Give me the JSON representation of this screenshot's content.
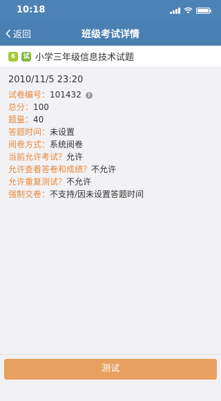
{
  "status_bar": {
    "time": "10:18",
    "icons": [
      "signal-icon",
      "wifi-icon",
      "battery-icon"
    ]
  },
  "nav": {
    "back_label": "返回",
    "title": "班级考试详情"
  },
  "exam": {
    "number_badge": "6",
    "type_badge": "试",
    "title": "小学三年级信息技术试题"
  },
  "details": {
    "date": "2010/11/5 23:20",
    "rows": [
      {
        "label": "试卷编号：",
        "value": "101432"
      },
      {
        "label": "总分：",
        "value": "100"
      },
      {
        "label": "题量：",
        "value": "40"
      },
      {
        "label": "答题时间：",
        "value": "未设置"
      },
      {
        "label": "阅卷方式：",
        "value": "系统阅卷"
      },
      {
        "label": "当前允许考试？",
        "value": "允许"
      },
      {
        "label": "允许查看答卷和成绩？",
        "value": "不允许"
      },
      {
        "label": "允许重复测试？",
        "value": "不允许"
      },
      {
        "label": "强制交卷：",
        "value": "不支持/因未设置答题时间"
      }
    ]
  },
  "actions": {
    "test_label": "测试"
  },
  "colors": {
    "nav_bg": "#4a7fb2",
    "label_orange": "#e8893a",
    "button_orange": "#e8a160",
    "badge_green": "#a6c83a"
  }
}
